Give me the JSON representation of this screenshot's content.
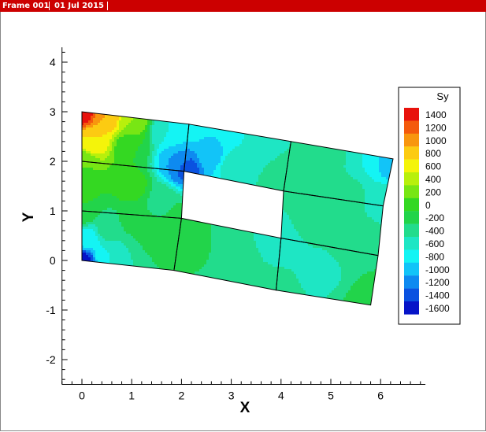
{
  "titlebar": {
    "frame_label": "Frame 001",
    "date_label": "01 Jul 2015",
    "background_color": "#cc0000"
  },
  "chart_data": {
    "type": "contour",
    "xlabel": "X",
    "ylabel": "Y",
    "xlim": [
      -0.4,
      6.9
    ],
    "ylim": [
      -2.5,
      4.3
    ],
    "x_ticks": [
      0,
      1,
      2,
      3,
      4,
      5,
      6
    ],
    "y_ticks": [
      -2,
      -1,
      0,
      1,
      2,
      3,
      4
    ],
    "legend": {
      "title": "Sy",
      "position": "right",
      "levels": [
        1400,
        1200,
        1000,
        800,
        600,
        400,
        200,
        0,
        -200,
        -400,
        -600,
        -800,
        -1000,
        -1200,
        -1400,
        -1600
      ],
      "colors": [
        "#e8120c",
        "#f45a0c",
        "#f8960e",
        "#fccb12",
        "#f4f40a",
        "#b8f00c",
        "#78e614",
        "#34d822",
        "#22d44a",
        "#22dc8c",
        "#1ee6c4",
        "#14f4f4",
        "#12c4f8",
        "#0e8af0",
        "#0a52e0",
        "#0614c8"
      ]
    },
    "mesh_nodes": {
      "n00": [
        0.0,
        0.0
      ],
      "n01": [
        1.85,
        -0.2
      ],
      "n02": [
        3.9,
        -0.6
      ],
      "n03": [
        5.8,
        -0.9
      ],
      "n10": [
        0.0,
        1.0
      ],
      "n11": [
        2.0,
        0.85
      ],
      "n12": [
        4.0,
        0.45
      ],
      "n13": [
        5.95,
        0.1
      ],
      "n20": [
        0.0,
        2.0
      ],
      "n21": [
        2.05,
        1.8
      ],
      "n22": [
        4.05,
        1.4
      ],
      "n23": [
        6.05,
        1.1
      ],
      "n30": [
        0.0,
        3.0
      ],
      "n31": [
        2.15,
        2.75
      ],
      "n32": [
        4.2,
        2.4
      ],
      "n33": [
        6.25,
        2.05
      ]
    },
    "elements": [
      [
        "n00",
        "n01",
        "n11",
        "n10"
      ],
      [
        "n01",
        "n02",
        "n12",
        "n11"
      ],
      [
        "n02",
        "n03",
        "n13",
        "n12"
      ],
      [
        "n10",
        "n11",
        "n21",
        "n20"
      ],
      [
        "n12",
        "n13",
        "n23",
        "n22"
      ],
      [
        "n20",
        "n21",
        "n31",
        "n30"
      ],
      [
        "n21",
        "n22",
        "n32",
        "n31"
      ],
      [
        "n22",
        "n23",
        "n33",
        "n32"
      ]
    ],
    "field_samples": [
      {
        "x": 0.0,
        "y": 3.0,
        "v": 1450
      },
      {
        "x": 0.5,
        "y": 2.9,
        "v": 900
      },
      {
        "x": 0.2,
        "y": 2.4,
        "v": 700
      },
      {
        "x": 1.0,
        "y": 2.8,
        "v": 300
      },
      {
        "x": 0.0,
        "y": 2.0,
        "v": 100
      },
      {
        "x": 1.0,
        "y": 2.3,
        "v": -100
      },
      {
        "x": 1.7,
        "y": 2.6,
        "v": -700
      },
      {
        "x": 2.15,
        "y": 2.75,
        "v": -800
      },
      {
        "x": 1.9,
        "y": 2.0,
        "v": -1100
      },
      {
        "x": 2.1,
        "y": 1.85,
        "v": -1400
      },
      {
        "x": 2.6,
        "y": 2.1,
        "v": -1000
      },
      {
        "x": 3.2,
        "y": 2.4,
        "v": -700
      },
      {
        "x": 3.0,
        "y": 1.9,
        "v": -600
      },
      {
        "x": 4.2,
        "y": 2.4,
        "v": -500
      },
      {
        "x": 4.0,
        "y": 1.5,
        "v": -400
      },
      {
        "x": 5.0,
        "y": 2.2,
        "v": -400
      },
      {
        "x": 5.7,
        "y": 2.1,
        "v": -700
      },
      {
        "x": 6.25,
        "y": 2.05,
        "v": -1100
      },
      {
        "x": 5.2,
        "y": 1.3,
        "v": -350
      },
      {
        "x": 6.05,
        "y": 1.1,
        "v": -550
      },
      {
        "x": 4.5,
        "y": 0.8,
        "v": -400
      },
      {
        "x": 4.0,
        "y": 0.5,
        "v": -700
      },
      {
        "x": 5.5,
        "y": 0.4,
        "v": -300
      },
      {
        "x": 5.95,
        "y": 0.1,
        "v": -300
      },
      {
        "x": 4.8,
        "y": -0.2,
        "v": -550
      },
      {
        "x": 5.8,
        "y": -0.9,
        "v": -200
      },
      {
        "x": 3.9,
        "y": -0.6,
        "v": -450
      },
      {
        "x": 3.0,
        "y": 0.2,
        "v": -350
      },
      {
        "x": 3.0,
        "y": -0.4,
        "v": -400
      },
      {
        "x": 2.2,
        "y": 0.3,
        "v": -250
      },
      {
        "x": 1.85,
        "y": -0.2,
        "v": -300
      },
      {
        "x": 0.0,
        "y": 1.5,
        "v": -50
      },
      {
        "x": 1.0,
        "y": 1.5,
        "v": 0
      },
      {
        "x": 1.6,
        "y": 1.2,
        "v": -350
      },
      {
        "x": 2.0,
        "y": 0.85,
        "v": -200
      },
      {
        "x": 0.0,
        "y": 1.0,
        "v": -100
      },
      {
        "x": 1.0,
        "y": 0.8,
        "v": -250
      },
      {
        "x": 1.5,
        "y": 0.4,
        "v": -100
      },
      {
        "x": 0.5,
        "y": 0.6,
        "v": -450
      },
      {
        "x": 0.1,
        "y": 0.4,
        "v": -850
      },
      {
        "x": 0.5,
        "y": 0.1,
        "v": -700
      },
      {
        "x": 1.0,
        "y": 0.0,
        "v": -500
      },
      {
        "x": 0.0,
        "y": 0.0,
        "v": -1600
      }
    ]
  }
}
